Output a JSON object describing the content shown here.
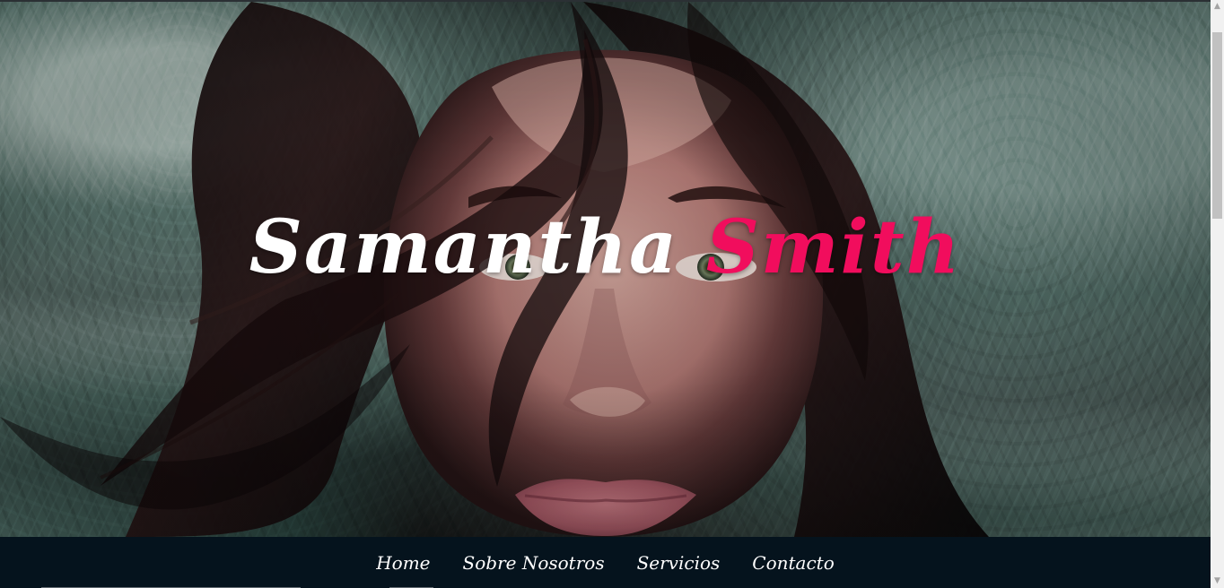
{
  "hero": {
    "first_name": "Samantha",
    "last_name": "Smith"
  },
  "navigation": {
    "items": [
      {
        "label": "Home"
      },
      {
        "label": "Sobre Nosotros"
      },
      {
        "label": "Servicios"
      },
      {
        "label": "Contacto"
      }
    ]
  },
  "colors": {
    "accent": "#f10d5d",
    "nav_background": "#05131d",
    "title_white": "#ffffff",
    "scrollbar_track": "#f1f1f1",
    "scrollbar_thumb": "#c1c1c1"
  },
  "icons": {
    "scroll_up": "triangle-up",
    "scroll_down": "triangle-down"
  }
}
